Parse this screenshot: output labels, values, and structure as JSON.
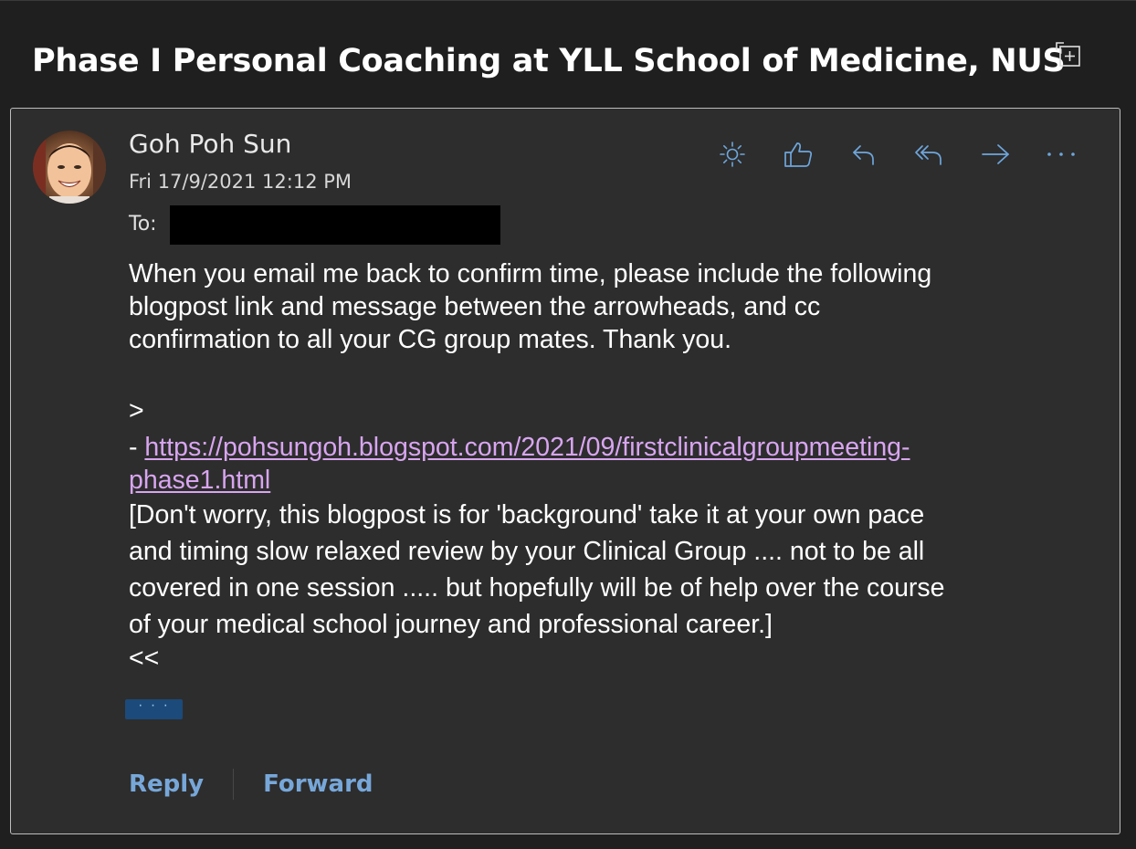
{
  "subject": "Phase I Personal Coaching at YLL School of Medicine, NUS",
  "message": {
    "sender": "Goh Poh Sun",
    "date": "Fri 17/9/2021 12:12 PM",
    "to_label": "To:",
    "body": {
      "paragraph1": [
        "When you email me back to confirm time, please include the following",
        "blogpost link and message between the arrowheads, and cc",
        "confirmation to all your CG group mates. Thank you."
      ],
      "open_arrow": ">",
      "link_prefix": "- ",
      "link_line1": "https://pohsungoh.blogspot.com/2021/09/firstclinicalgroupmeeting-",
      "link_line2": "phase1.html",
      "paragraph2": [
        "[Don't worry, this blogpost is for 'background' take it at your own pace",
        "and timing slow relaxed review by your Clinical Group .... not to be all",
        "covered in one session ..... but hopefully will be of help over the course",
        "of your medical school journey and professional career.]"
      ],
      "close_arrow": "<<"
    },
    "show_more": "· · ·"
  },
  "actions": [
    {
      "name": "brightness-icon"
    },
    {
      "name": "like-icon"
    },
    {
      "name": "reply-icon"
    },
    {
      "name": "reply-all-icon"
    },
    {
      "name": "forward-icon"
    },
    {
      "name": "more-icon"
    }
  ],
  "footer": {
    "reply_label": "Reply",
    "forward_label": "Forward"
  },
  "colors": {
    "background": "#1f1f1f",
    "card": "#2d2d2d",
    "accent": "#77a7d9",
    "link": "#d8a5f0",
    "icon": "#6ea6dc"
  }
}
